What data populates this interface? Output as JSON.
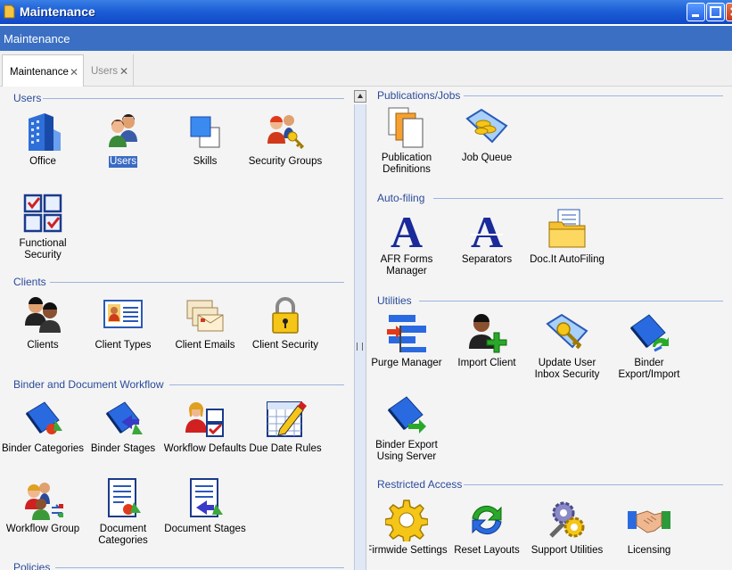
{
  "window": {
    "title": "Maintenance"
  },
  "header": {
    "title": "Maintenance"
  },
  "tabs": [
    {
      "label": "Maintenance",
      "close": "✕"
    },
    {
      "label": "Users",
      "close": "✕"
    }
  ],
  "left": {
    "users": {
      "title": "Users",
      "items": [
        {
          "label": "Office",
          "icon": "office-building-icon"
        },
        {
          "label": "Users",
          "icon": "users-icon",
          "selected": true
        },
        {
          "label": "Skills",
          "icon": "skills-icon"
        },
        {
          "label": "Security Groups",
          "icon": "security-groups-icon"
        },
        {
          "label1": "Functional",
          "label2": "Security",
          "icon": "functional-security-icon"
        }
      ]
    },
    "clients": {
      "title": "Clients",
      "items": [
        {
          "label": "Clients",
          "icon": "clients-icon"
        },
        {
          "label": "Client Types",
          "icon": "client-types-icon"
        },
        {
          "label": "Client Emails",
          "icon": "client-emails-icon"
        },
        {
          "label": "Client Security",
          "icon": "padlock-icon"
        }
      ]
    },
    "binder": {
      "title": "Binder and Document Workflow",
      "items": [
        {
          "label": "Binder Categories",
          "icon": "binder-categories-icon"
        },
        {
          "label": "Binder Stages",
          "icon": "binder-stages-icon"
        },
        {
          "label": "Workflow Defaults",
          "icon": "workflow-defaults-icon"
        },
        {
          "label": "Due Date Rules",
          "icon": "calendar-pencil-icon"
        },
        {
          "label": "Workflow Group",
          "icon": "workflow-group-icon"
        },
        {
          "label1": "Document",
          "label2": "Categories",
          "icon": "document-categories-icon"
        },
        {
          "label": "Document Stages",
          "icon": "document-stages-icon"
        }
      ]
    },
    "policies": {
      "title": "Policies"
    }
  },
  "right": {
    "publications": {
      "title": "Publications/Jobs",
      "items": [
        {
          "label1": "Publication",
          "label2": "Definitions",
          "icon": "publication-definitions-icon"
        },
        {
          "label": "Job Queue",
          "icon": "job-queue-icon"
        }
      ]
    },
    "autofiling": {
      "title": "Auto-filing",
      "items": [
        {
          "label1": "AFR Forms",
          "label2": "Manager",
          "icon": "afr-letter-a-icon",
          "glyph": "A"
        },
        {
          "label": "Separators",
          "icon": "separators-letter-a-icon",
          "glyph": "A"
        },
        {
          "label": "Doc.It AutoFiling",
          "icon": "folder-autofiling-icon"
        }
      ]
    },
    "utilities": {
      "title": "Utilities",
      "items": [
        {
          "label": "Purge Manager",
          "icon": "purge-manager-icon"
        },
        {
          "label": "Import Client",
          "icon": "import-client-icon"
        },
        {
          "label1": "Update User",
          "label2": "Inbox Security",
          "icon": "inbox-security-key-icon"
        },
        {
          "label1": "Binder",
          "label2": "Export/Import",
          "icon": "binder-export-import-icon"
        },
        {
          "label1": "Binder Export",
          "label2": "Using Server",
          "icon": "binder-export-server-icon"
        }
      ]
    },
    "restricted": {
      "title": "Restricted Access",
      "items": [
        {
          "label": "Firmwide Settings",
          "icon": "gear-icon"
        },
        {
          "label": "Reset Layouts",
          "icon": "refresh-arrows-icon"
        },
        {
          "label": "Support Utilities",
          "icon": "gears-wrench-icon"
        },
        {
          "label": "Licensing",
          "icon": "handshake-icon"
        }
      ]
    }
  }
}
